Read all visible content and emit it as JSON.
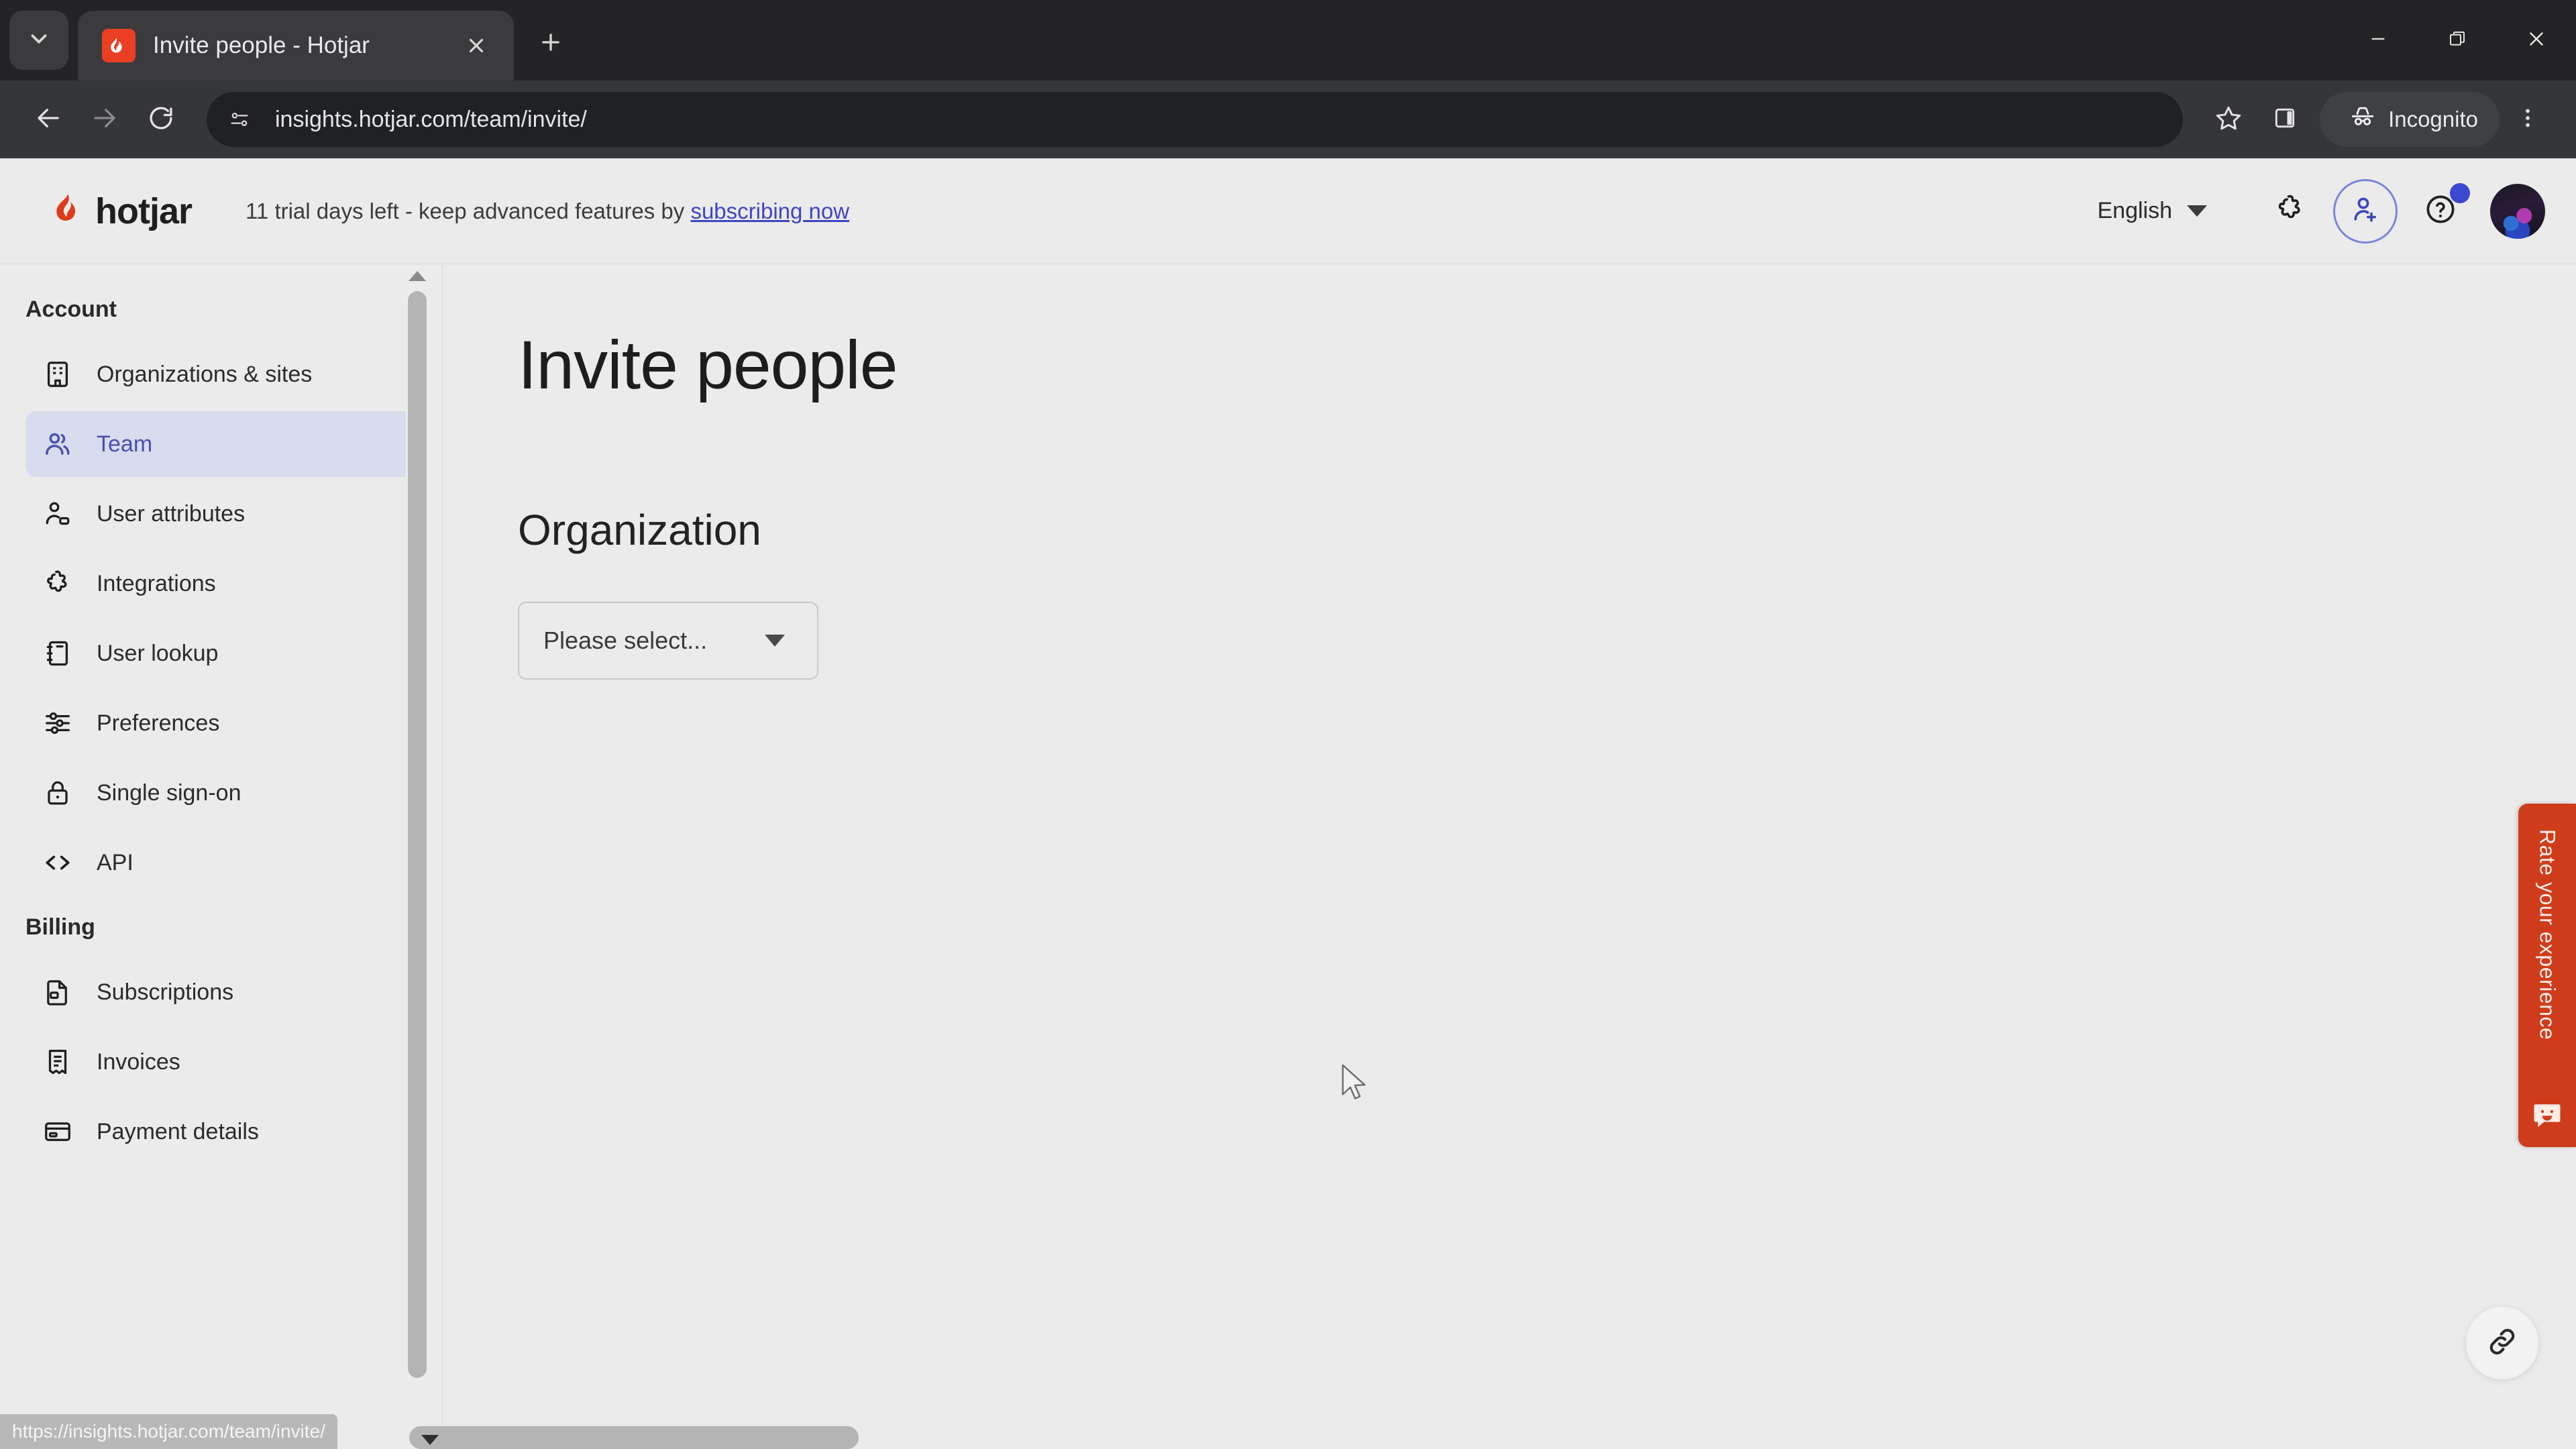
{
  "browser": {
    "tab_search_icon": "chevron-down-icon",
    "tab": {
      "favicon": "hotjar-favicon",
      "title": "Invite people - Hotjar",
      "close_icon": "close-icon"
    },
    "new_tab_icon": "plus-icon",
    "window_controls": {
      "minimize": "minimize-icon",
      "restore": "restore-icon",
      "close": "close-icon"
    },
    "toolbar": {
      "back_icon": "back-arrow-icon",
      "forward_icon": "forward-arrow-icon",
      "reload_icon": "reload-icon",
      "site_info_icon": "site-settings-icon",
      "url": "insights.hotjar.com/team/invite/",
      "bookmark_icon": "star-icon",
      "side_panel_icon": "side-panel-icon",
      "incognito_icon": "incognito-icon",
      "incognito_label": "Incognito",
      "menu_icon": "kebab-menu-icon"
    }
  },
  "app_header": {
    "logo_icon": "hotjar-flame-icon",
    "logo_text": "hotjar",
    "trial_text": "11 trial days left - keep advanced features by ",
    "trial_link": "subscribing now",
    "language": "English",
    "language_caret": "chevron-down-icon",
    "integrations_icon": "puzzle-piece-icon",
    "invite_icon": "add-user-icon",
    "help_icon": "question-mark-icon",
    "avatar": "user-avatar"
  },
  "sidebar": {
    "groups": [
      {
        "label": "Account",
        "items": [
          {
            "label": "Organizations & sites",
            "icon": "building-icon",
            "active": false
          },
          {
            "label": "Team",
            "icon": "people-icon",
            "active": true
          },
          {
            "label": "User attributes",
            "icon": "user-tag-icon",
            "active": false
          },
          {
            "label": "Integrations",
            "icon": "puzzle-piece-icon",
            "active": false
          },
          {
            "label": "User lookup",
            "icon": "notebook-icon",
            "active": false
          },
          {
            "label": "Preferences",
            "icon": "sliders-icon",
            "active": false
          },
          {
            "label": "Single sign-on",
            "icon": "lock-icon",
            "active": false
          },
          {
            "label": "API",
            "icon": "code-brackets-icon",
            "active": false
          }
        ]
      },
      {
        "label": "Billing",
        "items": [
          {
            "label": "Subscriptions",
            "icon": "document-lock-icon",
            "active": false
          },
          {
            "label": "Invoices",
            "icon": "receipt-icon",
            "active": false
          },
          {
            "label": "Payment details",
            "icon": "credit-card-icon",
            "active": false
          }
        ]
      }
    ]
  },
  "main": {
    "page_title": "Invite people",
    "section_title": "Organization",
    "org_select_value": "Please select...",
    "org_select_caret": "caret-down-icon"
  },
  "widgets": {
    "rate_tab_text": "Rate your experience",
    "rate_tab_icon": "smiley-chat-icon",
    "link_fab_icon": "link-icon"
  },
  "status_bar": {
    "url": "https://insights.hotjar.com/team/invite/"
  },
  "colors": {
    "hotjar_red": "#eb3f24",
    "rate_tab_red": "#cf3c1c",
    "accent_indigo": "#4b4fae",
    "active_item_bg": "#d7dcee",
    "notification_blue": "#3b49d1",
    "page_bg": "#ebebeb",
    "chrome_dark": "#35363a"
  }
}
